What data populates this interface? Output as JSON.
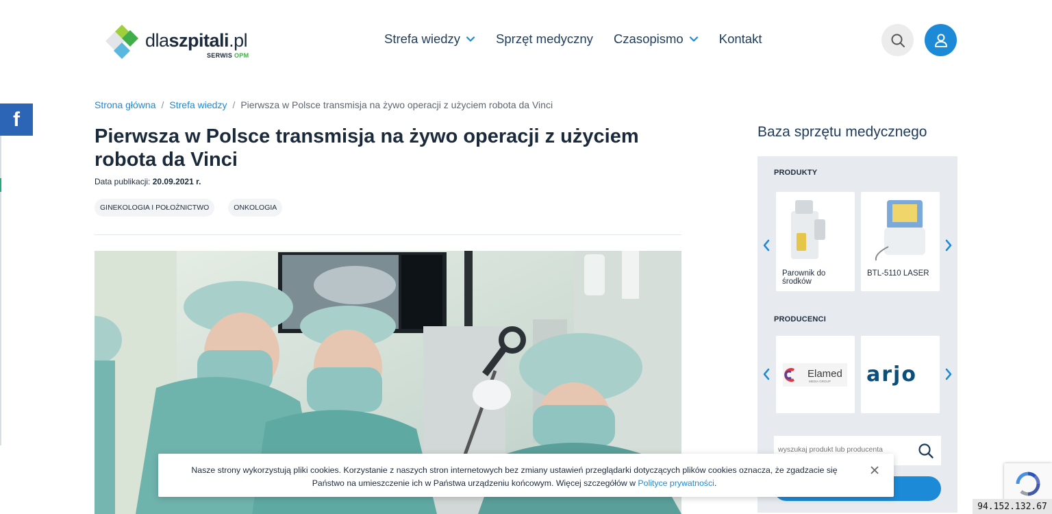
{
  "header": {
    "logo": {
      "text_regular": "dla",
      "text_bold": "szpitali",
      "text_tld": ".pl",
      "sub_label": "SERWIS",
      "sub_brand": "OPM"
    },
    "nav": [
      {
        "label": "Strefa wiedzy",
        "has_dropdown": true
      },
      {
        "label": "Sprzęt medyczny",
        "has_dropdown": false
      },
      {
        "label": "Czasopismo",
        "has_dropdown": true
      },
      {
        "label": "Kontakt",
        "has_dropdown": false
      }
    ],
    "search_icon": "search-icon",
    "user_icon": "user-icon"
  },
  "social": {
    "facebook_label": "f"
  },
  "breadcrumb": {
    "home": "Strona główna",
    "section": "Strefa wiedzy",
    "current": "Pierwsza w Polsce transmisja na żywo operacji z użyciem robota da Vinci",
    "separator": "/"
  },
  "article": {
    "title": "Pierwsza w Polsce transmisja na żywo operacji z użyciem robota da Vinci",
    "pub_label": "Data publikacji:",
    "pub_date": "20.09.2021 r.",
    "tags": [
      "GINEKOLOGIA I POŁOŻNICTWO",
      "ONKOLOGIA"
    ]
  },
  "sidebar": {
    "title": "Baza sprzętu medycznego",
    "products_label": "PRODUKTY",
    "products": [
      {
        "name": "Parownik do środków"
      },
      {
        "name": "BTL-5110 LASER"
      }
    ],
    "producers_label": "PRODUCENCI",
    "producers": [
      {
        "name": "Elamed",
        "tagline": "MEDIA GROUP"
      },
      {
        "name": "arjo"
      }
    ],
    "search_placeholder": "wyszukaj produkt lub producenta"
  },
  "cookie": {
    "text_line1": "Nasze strony wykorzystują pliki cookies. Korzystanie z naszych stron internetowych bez zmiany ustawień przeglądarki dotyczących plików cookies oznacza, że zgadzacie się",
    "text_line2": "Państwo na umieszczenie ich w Państwa urządzeniu końcowym. Więcej szczegółów w ",
    "link": "Polityce prywatności",
    "text_end": "."
  },
  "ip_address": "94.152.132.67",
  "colors": {
    "accent": "#1c8ad6",
    "text": "#1b2a3a",
    "facebook": "#2c65b5",
    "panel": "#e7ebef"
  }
}
